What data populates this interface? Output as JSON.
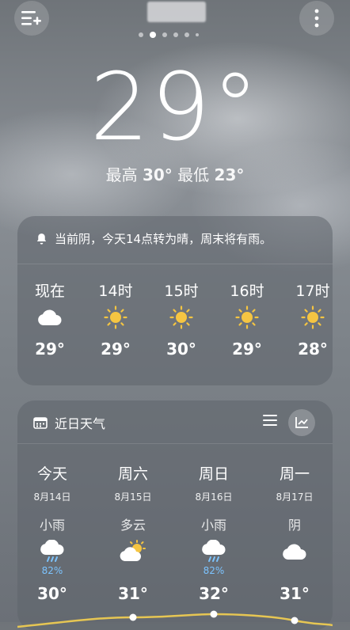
{
  "header": {
    "menu_icon": "add-city-menu-icon",
    "more_icon": "more-vertical-icon",
    "page_dots": {
      "count": 7,
      "active_index": 1
    }
  },
  "current": {
    "temperature": "29°",
    "high_label": "最高",
    "high": "30°",
    "low_label": "最低",
    "low": "23°"
  },
  "hourly_card": {
    "alert_icon": "bell-icon",
    "alert_text": "当前阴，今天14点转为晴，周末将有雨。",
    "hours": [
      {
        "label": "现在",
        "icon": "cloud-icon",
        "temp": "29°"
      },
      {
        "label": "14时",
        "icon": "sun-icon",
        "temp": "29°"
      },
      {
        "label": "15时",
        "icon": "sun-icon",
        "temp": "30°"
      },
      {
        "label": "16时",
        "icon": "sun-icon",
        "temp": "29°"
      },
      {
        "label": "17时",
        "icon": "sun-icon",
        "temp": "28°"
      }
    ]
  },
  "daily_card": {
    "title_icon": "calendar-icon",
    "title": "近日天气",
    "list_icon": "list-view-icon",
    "chart_icon": "trend-chart-icon",
    "days": [
      {
        "name": "今天",
        "date": "8月14日",
        "condition": "小雨",
        "icon": "cloud-rain-icon",
        "pop": "82%",
        "temp": "30°"
      },
      {
        "name": "周六",
        "date": "8月15日",
        "condition": "多云",
        "icon": "partly-cloudy-icon",
        "pop": "",
        "temp": "31°"
      },
      {
        "name": "周日",
        "date": "8月16日",
        "condition": "小雨",
        "icon": "cloud-rain-icon",
        "pop": "82%",
        "temp": "32°"
      },
      {
        "name": "周一",
        "date": "8月17日",
        "condition": "阴",
        "icon": "cloud-icon",
        "pop": "",
        "temp": "31°"
      }
    ]
  },
  "colors": {
    "accent_pop": "#7cc4ff",
    "sun": "#f5c542",
    "trend_line": "#e6c653"
  }
}
